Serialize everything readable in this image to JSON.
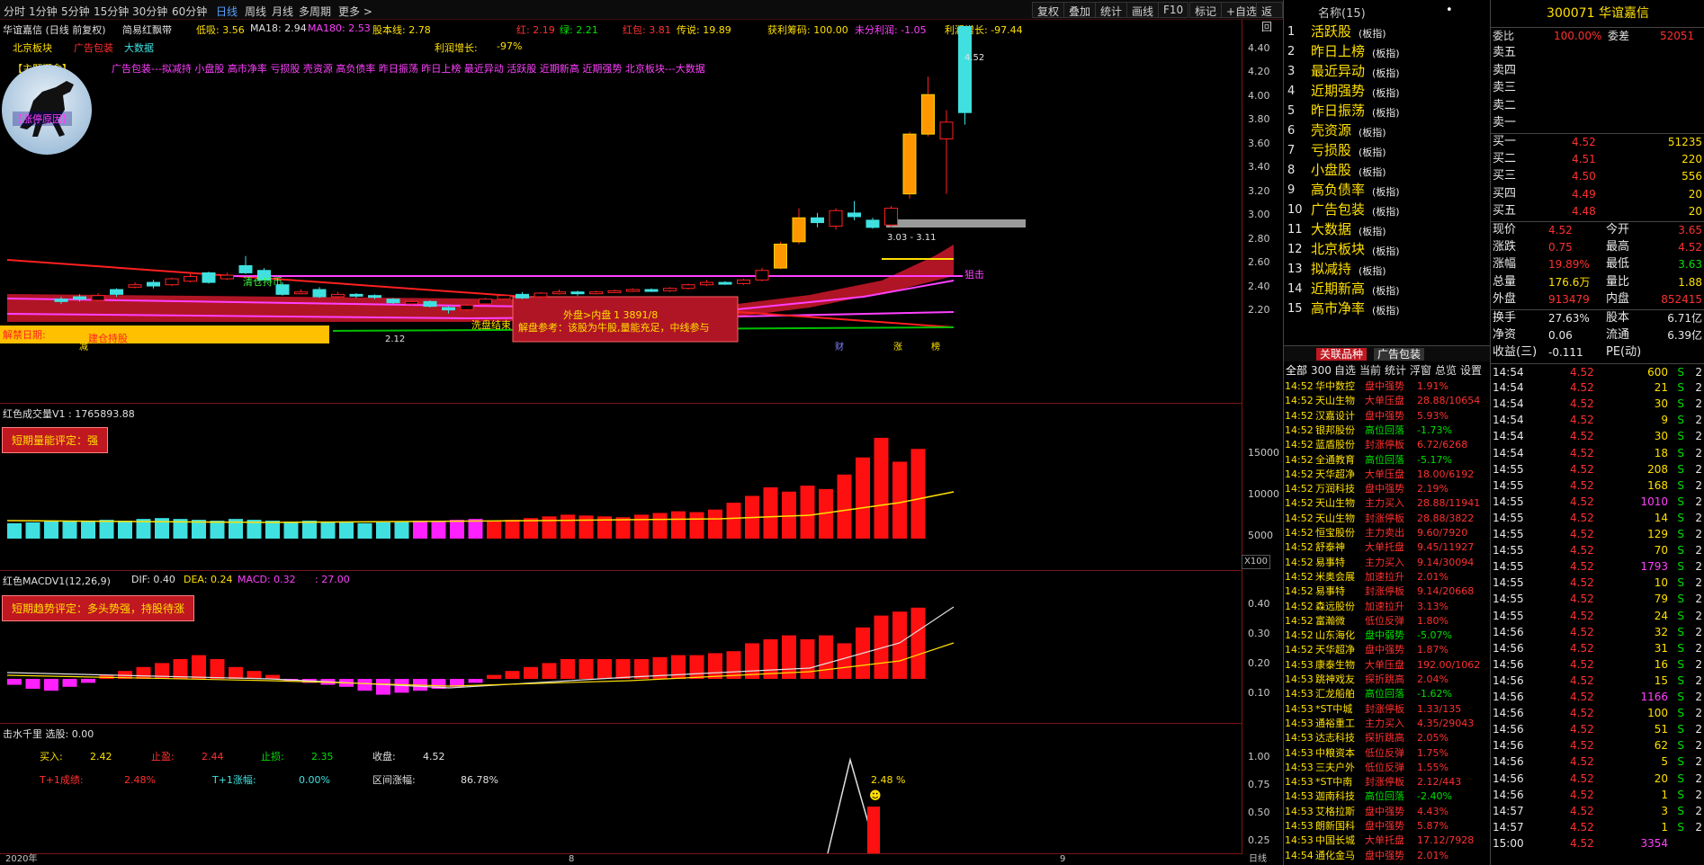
{
  "toolbar": {
    "periods": [
      "分时",
      "1分钟",
      "5分钟",
      "15分钟",
      "30分钟",
      "60分钟",
      "日线",
      "周线",
      "月线",
      "多周期",
      "更多 >"
    ],
    "active": "日线",
    "tools": [
      "复权",
      "叠加",
      "统计",
      "画线",
      "F10",
      "标记",
      "+自选",
      "返回"
    ]
  },
  "kline": {
    "title": "华谊嘉信 (日线 前复权)",
    "indicator_name": "简易红飘带",
    "low_label": "低吸: 3.56",
    "ma18": "MA18: 2.94",
    "ma180": "MA180: 2.53",
    "stock_line": "股本线: 2.78",
    "red_count": "红: 2.19",
    "green_count": "绿: 2.21",
    "red_pack": "红包: 3.81",
    "legend": "传说: 19.89",
    "chips": "获利筹码: 100.00",
    "unprofit": "未分利润: -1.05",
    "profit_growth": "利润增长: -97.44",
    "tags": [
      "北京板块",
      "广告包装",
      "大数据"
    ],
    "profit_growth2_label": "利润增长:",
    "profit_growth2_val": "-97%",
    "concept_label": "【主题概念】",
    "concepts": "广告包装---拟减持 小盘股 高市净率 亏损股 壳资源 高负债率 昨日振荡 昨日上榜 最近异动 活跃股 近期新高 近期强势 北京板块---大数据",
    "limitup_label": "【涨停原因】",
    "ban_date": "解禁日期:",
    "ann_build": "建仓持股",
    "ann_clear": "清仓持币",
    "ann_fill": "洗盘结束",
    "ann_sniper": "狙击",
    "ann_reduce": "减",
    "outer": "外盘>内盘",
    "outer_val": "1 3891/8",
    "interp": "解盘参考：该股为牛股,量能充足，中线参与",
    "range_label": "3.03 - 3.11",
    "max_label": "4.52",
    "min_label": "2.12",
    "markers": [
      "财",
      "涨",
      "榜"
    ],
    "yticks": [
      "4.40",
      "4.20",
      "4.00",
      "3.80",
      "3.60",
      "3.40",
      "3.20",
      "3.00",
      "2.80",
      "2.60",
      "2.40",
      "2.20"
    ]
  },
  "volume": {
    "title": "红色成交量V1 : 1765893.88",
    "badge": "短期量能评定：强",
    "yticks": [
      "15000",
      "10000",
      "5000"
    ],
    "unit": "X100"
  },
  "macd": {
    "title": "红色MACDV1(12,26,9)",
    "dif": "DIF: 0.40",
    "dea": "DEA: 0.24",
    "macd": "MACD: 0.32",
    "extra": ": 27.00",
    "badge": "短期趋势评定：多头势强，持股待涨",
    "yticks": [
      "0.40",
      "0.30",
      "0.20",
      "0.10"
    ]
  },
  "jishui": {
    "title": "击水千里  选股: 0.00",
    "buy_label": "买入:",
    "buy": "2.42",
    "stop_profit_label": "止盈:",
    "stop_profit": "2.44",
    "stop_loss_label": "止损:",
    "stop_loss": "2.35",
    "close_label": "收盘:",
    "close": "4.52",
    "t1_label": "T+1成绩:",
    "t1": "2.48%",
    "t1amp_label": "T+1涨幅:",
    "t1amp": "0.00%",
    "range_label": "区间涨幅:",
    "range": "86.78%",
    "peak_label": "2.48 %",
    "yticks": [
      "1.00",
      "0.75",
      "0.50",
      "0.25"
    ]
  },
  "xaxis": {
    "labels": [
      "2020年",
      "8",
      "9"
    ],
    "mode": "日线"
  },
  "sector": {
    "header": "名称(15)",
    "items": [
      {
        "n": "1",
        "name": "活跃股",
        "tag": "(板指)"
      },
      {
        "n": "2",
        "name": "昨日上榜",
        "tag": "(板指)"
      },
      {
        "n": "3",
        "name": "最近异动",
        "tag": "(板指)"
      },
      {
        "n": "4",
        "name": "近期强势",
        "tag": "(板指)"
      },
      {
        "n": "5",
        "name": "昨日振荡",
        "tag": "(板指)"
      },
      {
        "n": "6",
        "name": "壳资源",
        "tag": "(板指)"
      },
      {
        "n": "7",
        "name": "亏损股",
        "tag": "(板指)"
      },
      {
        "n": "8",
        "name": "小盘股",
        "tag": "(板指)"
      },
      {
        "n": "9",
        "name": "高负债率",
        "tag": "(板指)"
      },
      {
        "n": "10",
        "name": "广告包装",
        "tag": "(板指)"
      },
      {
        "n": "11",
        "name": "大数据",
        "tag": "(板指)"
      },
      {
        "n": "12",
        "name": "北京板块",
        "tag": "(板指)"
      },
      {
        "n": "13",
        "name": "拟减持",
        "tag": "(板指)"
      },
      {
        "n": "14",
        "name": "近期新高",
        "tag": "(板指)"
      },
      {
        "n": "15",
        "name": "高市净率",
        "tag": "(板指)"
      }
    ],
    "tabs": [
      "关联品种",
      "广告包装"
    ]
  },
  "alerts": {
    "rows": [
      [
        "14:52",
        "华中数控",
        "盘中强势",
        "1.91%"
      ],
      [
        "14:52",
        "天山生物",
        "大单压盘",
        "28.88/10654"
      ],
      [
        "14:52",
        "汉嘉设计",
        "盘中强势",
        "5.93%"
      ],
      [
        "14:52",
        "银邦股份",
        "高位回落",
        "-1.73%"
      ],
      [
        "14:52",
        "蓝盾股份",
        "封涨停板",
        "6.72/6268"
      ],
      [
        "14:52",
        "全通教育",
        "高位回落",
        "-5.17%"
      ],
      [
        "14:52",
        "天华超净",
        "大单压盘",
        "18.00/6192"
      ],
      [
        "14:52",
        "万润科技",
        "盘中强势",
        "2.19%"
      ],
      [
        "14:52",
        "天山生物",
        "主力买入",
        "28.88/11941"
      ],
      [
        "14:52",
        "天山生物",
        "封涨停板",
        "28.88/3822"
      ],
      [
        "14:52",
        "恒宝股份",
        "主力卖出",
        "9.60/7920"
      ],
      [
        "14:52",
        "舒泰神",
        "大单托盘",
        "9.45/11927"
      ],
      [
        "14:52",
        "易事特",
        "主力买入",
        "9.14/30094"
      ],
      [
        "14:52",
        "米奥会展",
        "加速拉升",
        "2.01%"
      ],
      [
        "14:52",
        "易事特",
        "封涨停板",
        "9.14/20668"
      ],
      [
        "14:52",
        "森远股份",
        "加速拉升",
        "3.13%"
      ],
      [
        "14:52",
        "富瀚微",
        "低位反弹",
        "1.80%"
      ],
      [
        "14:52",
        "山东海化",
        "盘中弱势",
        "-5.07%"
      ],
      [
        "14:52",
        "天华超净",
        "盘中强势",
        "1.87%"
      ],
      [
        "14:53",
        "康泰生物",
        "大单压盘",
        "192.00/1062"
      ],
      [
        "14:53",
        "跳神戏友",
        "探折跳高",
        "2.04%"
      ],
      [
        "14:53",
        "汇龙船舶",
        "高位回落",
        "-1.62%"
      ],
      [
        "14:53",
        "*ST中城",
        "封涨停板",
        "1.33/135"
      ],
      [
        "14:53",
        "通裕重工",
        "主力买入",
        "4.35/29043"
      ],
      [
        "14:53",
        "达志科技",
        "探折跳高",
        "2.05%"
      ],
      [
        "14:53",
        "中粮资本",
        "低位反弹",
        "1.75%"
      ],
      [
        "14:53",
        "三夫户外",
        "低位反弹",
        "1.55%"
      ],
      [
        "14:53",
        "*ST中南",
        "封涨停板",
        "2.12/443"
      ],
      [
        "14:53",
        "迦南科技",
        "高位回落",
        "-2.40%"
      ],
      [
        "14:53",
        "艾格拉斯",
        "盘中强势",
        "4.43%"
      ],
      [
        "14:53",
        "朗新国科",
        "盘中强势",
        "5.87%"
      ],
      [
        "14:53",
        "中国长城",
        "大单托盘",
        "17.12/7928"
      ],
      [
        "14:54",
        "通化金马",
        "盘中强势",
        "2.01%"
      ]
    ],
    "tabs": [
      "全部",
      "300",
      "自选",
      "当前",
      "统计",
      "浮窗",
      "总览",
      "设置"
    ]
  },
  "quote": {
    "code": "300071",
    "name": "华谊嘉信",
    "wb_label": "委比",
    "wb": "100.00%",
    "wc_label": "委差",
    "wc": "52051",
    "sells": [
      "卖五",
      "卖四",
      "卖三",
      "卖二",
      "卖一"
    ],
    "buys": [
      [
        "买一",
        "4.52",
        "51235"
      ],
      [
        "买二",
        "4.51",
        "220"
      ],
      [
        "买三",
        "4.50",
        "556"
      ],
      [
        "买四",
        "4.49",
        "20"
      ],
      [
        "买五",
        "4.48",
        "20"
      ]
    ],
    "stats": [
      [
        "现价",
        "4.52",
        "今开",
        "3.65"
      ],
      [
        "涨跌",
        "0.75",
        "最高",
        "4.52"
      ],
      [
        "涨幅",
        "19.89%",
        "最低",
        "3.63"
      ],
      [
        "总量",
        "176.6万",
        "量比",
        "1.88"
      ],
      [
        "外盘",
        "913479",
        "内盘",
        "852415"
      ]
    ],
    "stats2": [
      [
        "换手",
        "27.63%",
        "股本",
        "6.71亿"
      ],
      [
        "净资",
        "0.06",
        "流通",
        "6.39亿"
      ],
      [
        "收益(三)",
        "-0.111",
        "PE(动)",
        ""
      ]
    ]
  },
  "ticks": [
    [
      "14:54",
      "4.52",
      "600",
      "S",
      "2"
    ],
    [
      "14:54",
      "4.52",
      "21",
      "S",
      "2"
    ],
    [
      "14:54",
      "4.52",
      "30",
      "S",
      "2"
    ],
    [
      "14:54",
      "4.52",
      "9",
      "S",
      "2"
    ],
    [
      "14:54",
      "4.52",
      "30",
      "S",
      "2"
    ],
    [
      "14:54",
      "4.52",
      "18",
      "S",
      "2"
    ],
    [
      "14:55",
      "4.52",
      "208",
      "S",
      "2"
    ],
    [
      "14:55",
      "4.52",
      "168",
      "S",
      "2"
    ],
    [
      "14:55",
      "4.52",
      "1010",
      "S",
      "2"
    ],
    [
      "14:55",
      "4.52",
      "14",
      "S",
      "2"
    ],
    [
      "14:55",
      "4.52",
      "129",
      "S",
      "2"
    ],
    [
      "14:55",
      "4.52",
      "70",
      "S",
      "2"
    ],
    [
      "14:55",
      "4.52",
      "1793",
      "S",
      "2"
    ],
    [
      "14:55",
      "4.52",
      "10",
      "S",
      "2"
    ],
    [
      "14:55",
      "4.52",
      "79",
      "S",
      "2"
    ],
    [
      "14:55",
      "4.52",
      "24",
      "S",
      "2"
    ],
    [
      "14:56",
      "4.52",
      "32",
      "S",
      "2"
    ],
    [
      "14:56",
      "4.52",
      "31",
      "S",
      "2"
    ],
    [
      "14:56",
      "4.52",
      "16",
      "S",
      "2"
    ],
    [
      "14:56",
      "4.52",
      "15",
      "S",
      "2"
    ],
    [
      "14:56",
      "4.52",
      "1166",
      "S",
      "2"
    ],
    [
      "14:56",
      "4.52",
      "100",
      "S",
      "2"
    ],
    [
      "14:56",
      "4.52",
      "51",
      "S",
      "2"
    ],
    [
      "14:56",
      "4.52",
      "62",
      "S",
      "2"
    ],
    [
      "14:56",
      "4.52",
      "5",
      "S",
      "2"
    ],
    [
      "14:56",
      "4.52",
      "20",
      "S",
      "2"
    ],
    [
      "14:56",
      "4.52",
      "1",
      "S",
      "2"
    ],
    [
      "14:57",
      "4.52",
      "3",
      "S",
      "2"
    ],
    [
      "14:57",
      "4.52",
      "1",
      "S",
      "2"
    ],
    [
      "15:00",
      "4.52",
      "3354",
      "",
      ""
    ]
  ],
  "colors": {
    "up": "#ff2020",
    "down": "#40e0e0",
    "ribbon": "#c01828",
    "accent": "#ffe000"
  }
}
